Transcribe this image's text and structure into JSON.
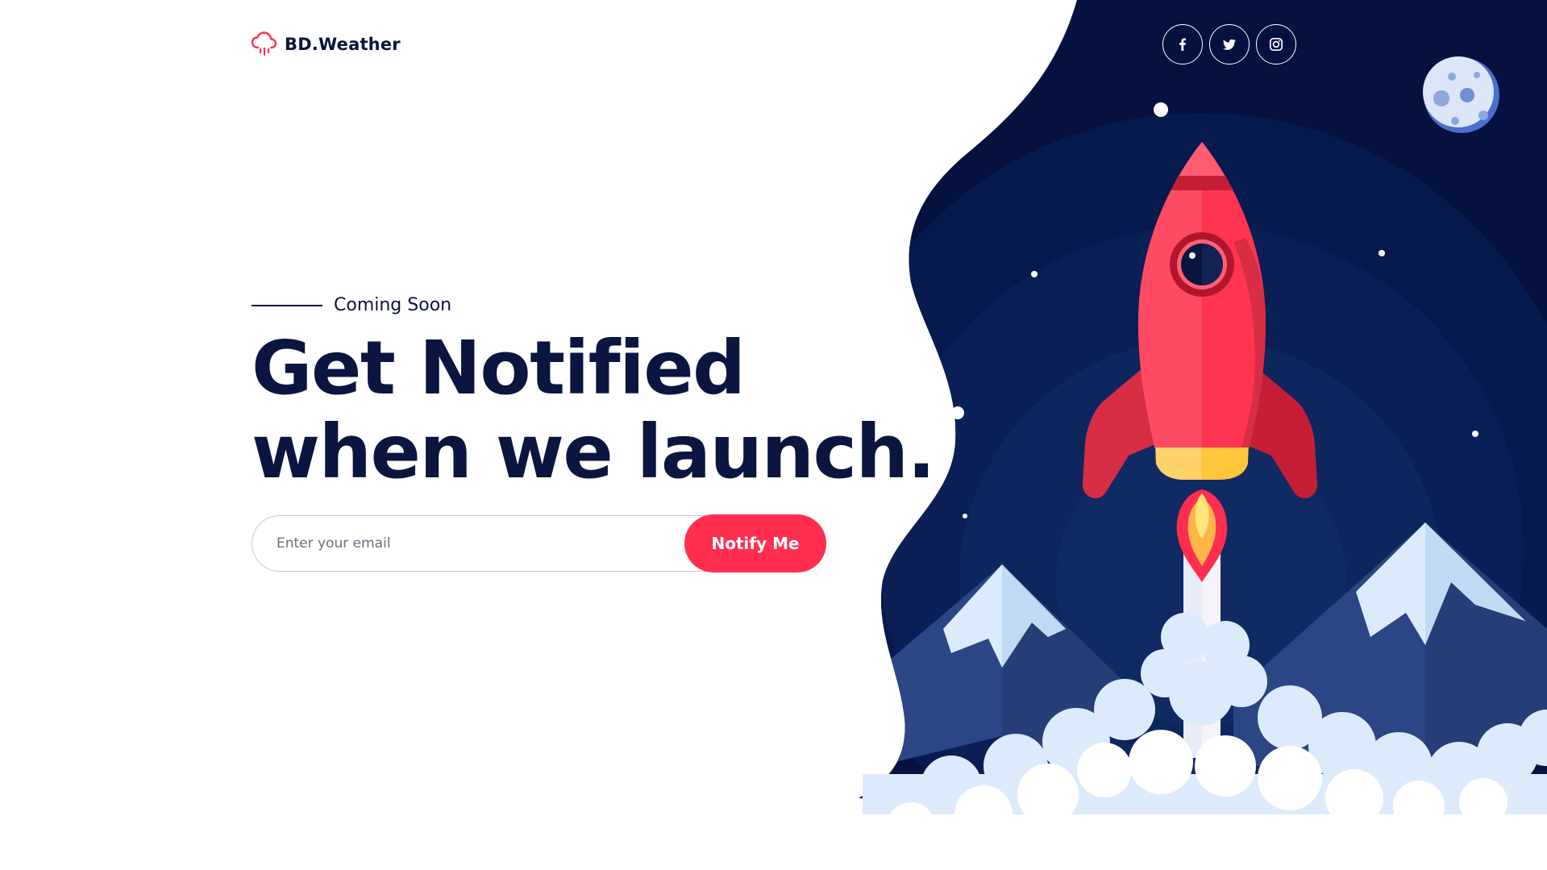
{
  "brand": {
    "name": "BD.Weather",
    "logo_icon": "cloud-rain-icon"
  },
  "social": [
    {
      "name": "facebook",
      "icon": "facebook-icon"
    },
    {
      "name": "twitter",
      "icon": "twitter-icon"
    },
    {
      "name": "instagram",
      "icon": "instagram-icon"
    }
  ],
  "hero": {
    "eyebrow": "Coming Soon",
    "headline_line1": "Get Notified",
    "headline_line2": "when we launch."
  },
  "form": {
    "email_placeholder": "Enter your email",
    "email_value": "",
    "submit_label": "Notify Me"
  },
  "colors": {
    "accent": "#ff2e4f",
    "navy": "#0a1540",
    "space_dark": "#05113f",
    "space_mid": "#0b2259",
    "mountain": "#2c4585",
    "snow": "#dcebfb"
  }
}
